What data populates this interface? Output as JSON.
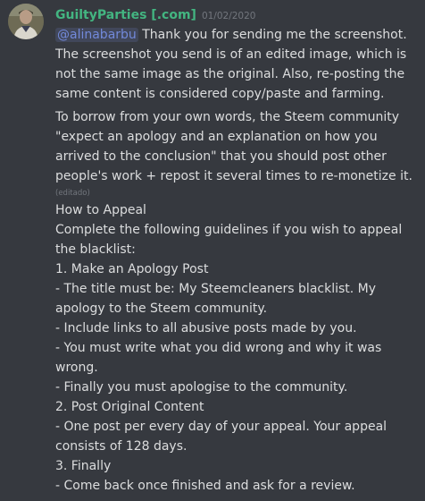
{
  "message": {
    "username": "GuiltyParties [.com]",
    "timestamp": "01/02/2020",
    "avatar_icon": "profile-photo-icon",
    "colors": {
      "username": "#43b581",
      "mention": "#7289da",
      "background": "#36393f",
      "text": "#dcddde",
      "muted": "#72767d"
    },
    "mention": "@alinabarbu",
    "paragraph1_rest": " Thank you for sending me the screenshot. The screenshot you send is of an edited image, which is not the same image as the original. Also, re-posting the same content is considered copy/paste and farming.",
    "paragraph2": "To borrow from your own words, the Steem community \"expect an apology and an explanation on how you arrived to the conclusion\" that you should post other people's work + repost it several times to re-monetize it.",
    "edited_label": "(editado)",
    "appeal_lines": [
      "How to Appeal",
      "Complete the following guidelines if you wish to appeal the blacklist:",
      "1. Make an Apology Post",
      "- The title must be: My Steemcleaners blacklist. My apology to the Steem community.",
      "- Include links to all abusive posts made by you.",
      "- You must write what you did wrong and why it was wrong.",
      "- Finally you must apologise to the community.",
      "2. Post Original Content",
      "- One post per every day of your appeal. Your appeal consists of 128 days.",
      "3. Finally",
      "- Come back once finished and ask for a review."
    ]
  }
}
